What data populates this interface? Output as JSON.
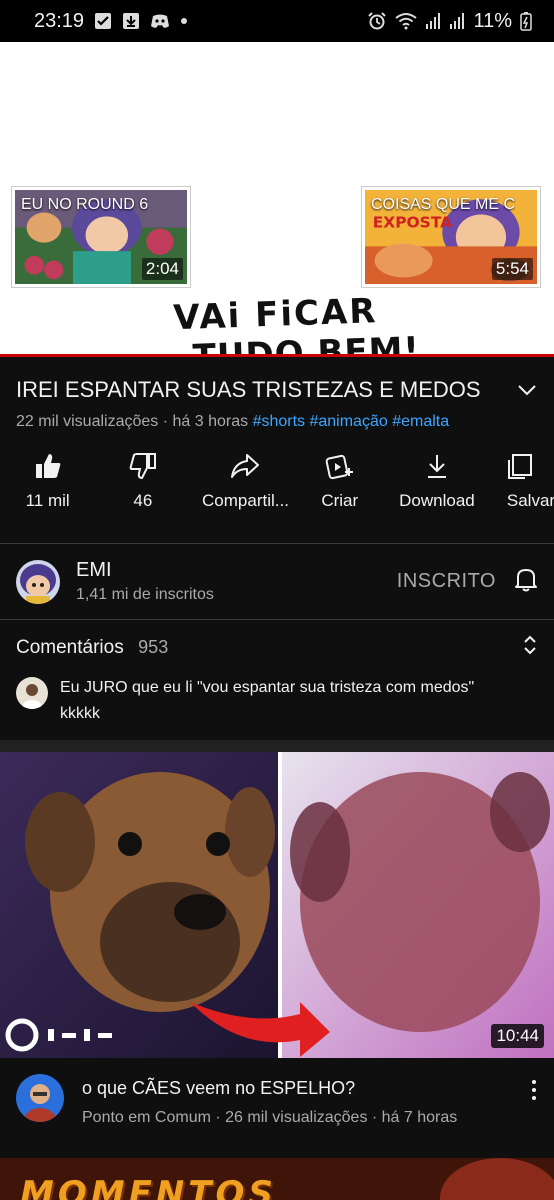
{
  "status_bar": {
    "time": "23:19",
    "battery": "11%"
  },
  "player": {
    "endcard_left": {
      "title": "EU NO ROUND 6",
      "duration": "2:04"
    },
    "endcard_right": {
      "title": "COISAS QUE ME C",
      "duration": "5:54"
    },
    "handwritten_line1": "VAi FiCAR",
    "handwritten_line2": "TUDO BEM!"
  },
  "video": {
    "title": "IREI ESPANTAR SUAS TRISTEZAS E MEDOS",
    "meta": "22 mil visualizações · há 3 horas",
    "hashtags": "#shorts #animação #emalta"
  },
  "actions": {
    "like": "11 mil",
    "dislike": "46",
    "share": "Compartil...",
    "create": "Criar",
    "download": "Download",
    "save": "Salvar"
  },
  "channel": {
    "name": "EMI",
    "subscribers": "1,41 mi de inscritos",
    "subscribe_state": "INSCRITO"
  },
  "comments": {
    "title": "Comentários",
    "count": "953",
    "top_comment_line1": "Eu JURO que eu li \"vou espantar sua tristeza com medos\"",
    "top_comment_line2": "kkkkk"
  },
  "next_video": {
    "duration": "10:44",
    "title": "o que CÃES veem no ESPELHO?",
    "meta": "Ponto em Comum · 26 mil visualizações · há 7 horas"
  },
  "next_next_video": {
    "thumb_text": "MOMENTOS"
  },
  "colors": {
    "background": "#0f0f0f",
    "link": "#3ea6ff",
    "progress": "#cc0000"
  }
}
